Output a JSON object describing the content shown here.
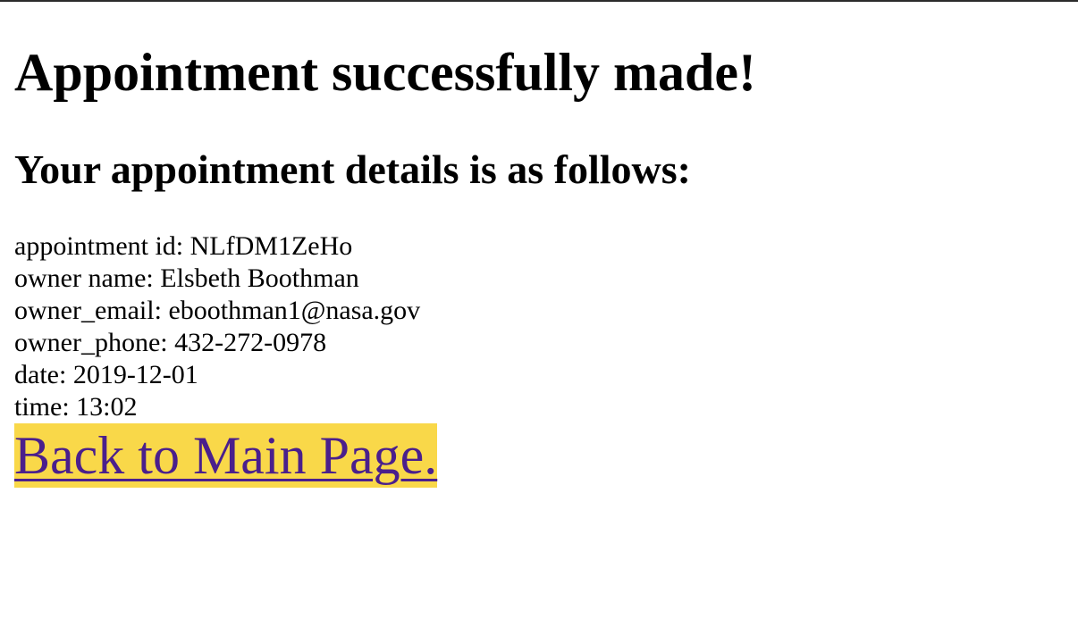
{
  "page": {
    "title": "Appointment successfully made!",
    "subtitle": "Your appointment details is as follows:"
  },
  "details": [
    {
      "label": "appointment id: ",
      "value": "NLfDM1ZeHo"
    },
    {
      "label": "owner name: ",
      "value": "Elsbeth Boothman"
    },
    {
      "label": "owner_email: ",
      "value": "eboothman1@nasa.gov"
    },
    {
      "label": "owner_phone: ",
      "value": "432-272-0978"
    },
    {
      "label": "date: ",
      "value": "2019-12-01"
    },
    {
      "label": "time: ",
      "value": "13:02"
    }
  ],
  "back_link": {
    "label": "Back to Main Page."
  },
  "colors": {
    "link": "#4a1f8c",
    "link_highlight": "#f9d849"
  }
}
